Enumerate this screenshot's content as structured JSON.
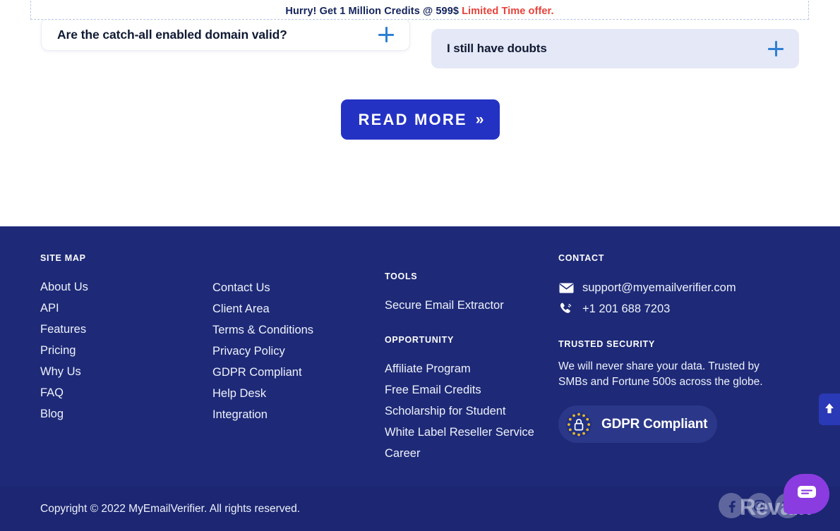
{
  "promo": {
    "text": "Hurry! Get 1 Million Credits @ 599$",
    "highlight": "Limited Time offer.",
    "highlight_color": "#e8413a"
  },
  "faq": {
    "items": [
      {
        "question": "Are the catch-all enabled domain valid?",
        "toggle": "plus"
      },
      {
        "question": "I still have doubts",
        "toggle": "plus"
      }
    ],
    "read_more_label": "READ MORE",
    "read_more_chevron": "»",
    "accent_color": "#2432c4"
  },
  "footer": {
    "background": "#1e2a77",
    "columns": {
      "sitemap": {
        "heading": "SITE MAP",
        "links": [
          "About Us",
          "API",
          "Features",
          "Pricing",
          "Why Us",
          "FAQ",
          "Blog"
        ]
      },
      "secondary": {
        "links": [
          "Contact Us",
          "Client Area",
          "Terms & Conditions",
          "Privacy Policy",
          "GDPR Compliant",
          "Help Desk",
          "Integration"
        ]
      },
      "tools": {
        "heading": "TOOLS",
        "links": [
          "Secure Email Extractor"
        ]
      },
      "opportunity": {
        "heading": "OPPORTUNITY",
        "links": [
          "Affiliate Program",
          "Free Email Credits",
          "Scholarship for Student",
          "White Label Reseller Service",
          "Career"
        ]
      },
      "contact": {
        "heading": "CONTACT",
        "email": "support@myemailverifier.com",
        "email_icon": "envelope-icon",
        "phone": "+1 201 688 7203",
        "phone_icon": "phone-icon",
        "trusted_heading": "TRUSTED SECURITY",
        "trusted_text": "We will never share your data. Trusted by SMBs and Fortune 500s across the globe.",
        "gdpr_label": "GDPR Compliant",
        "gdpr_icon": "gdpr-lock-stars-icon"
      }
    },
    "bottom": {
      "copyright": "Copyright © 2022 MyEmailVerifier. All rights reserved.",
      "socials": [
        "facebook-icon",
        "instagram-icon",
        "twitter-icon"
      ]
    }
  },
  "overlays": {
    "watermark": "Revain",
    "chat_icon": "chat-bubble-icon",
    "scroll_top_icon": "arrow-up-icon"
  }
}
